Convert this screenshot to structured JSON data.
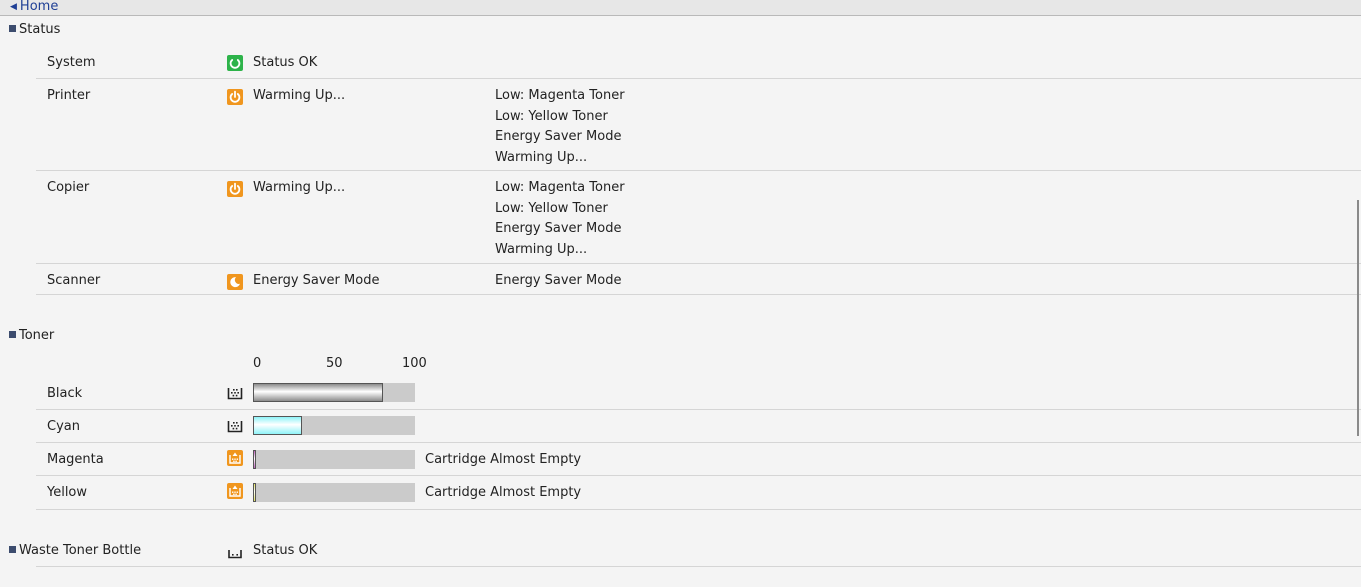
{
  "nav": {
    "home_label": "Home"
  },
  "status": {
    "title": "Status",
    "rows": [
      {
        "label": "System",
        "status": "Status OK",
        "icon": "status-ok-icon",
        "details": []
      },
      {
        "label": "Printer",
        "status": "Warming Up...",
        "icon": "power-warmup-icon",
        "details": [
          "Low: Magenta Toner",
          "Low: Yellow Toner",
          "Energy Saver Mode",
          "Warming Up..."
        ]
      },
      {
        "label": "Copier",
        "status": "Warming Up...",
        "icon": "power-warmup-icon",
        "details": [
          "Low: Magenta Toner",
          "Low: Yellow Toner",
          "Energy Saver Mode",
          "Warming Up..."
        ]
      },
      {
        "label": "Scanner",
        "status": "Energy Saver Mode",
        "icon": "energy-saver-icon",
        "details": [
          "Energy Saver Mode"
        ]
      }
    ]
  },
  "toner": {
    "title": "Toner",
    "scale": [
      "0",
      "50",
      "100"
    ],
    "rows": [
      {
        "label": "Black",
        "level_percent": 80,
        "color": "#8c8c8c",
        "icon": "toner-ok-icon",
        "note": ""
      },
      {
        "label": "Cyan",
        "level_percent": 30,
        "color": "#8ff3f8",
        "icon": "toner-ok-icon",
        "note": ""
      },
      {
        "label": "Magenta",
        "level_percent": 1,
        "color": "#c060c0",
        "icon": "toner-warning-icon",
        "note": "Cartridge Almost Empty"
      },
      {
        "label": "Yellow",
        "level_percent": 1,
        "color": "#e8e860",
        "icon": "toner-warning-icon",
        "note": "Cartridge Almost Empty"
      }
    ]
  },
  "waste": {
    "title": "Waste Toner Bottle",
    "status": "Status OK",
    "icon": "waste-bottle-icon"
  },
  "colors": {
    "ok": "#2db34a",
    "warning": "#f0961e",
    "link": "#1f3f95"
  }
}
